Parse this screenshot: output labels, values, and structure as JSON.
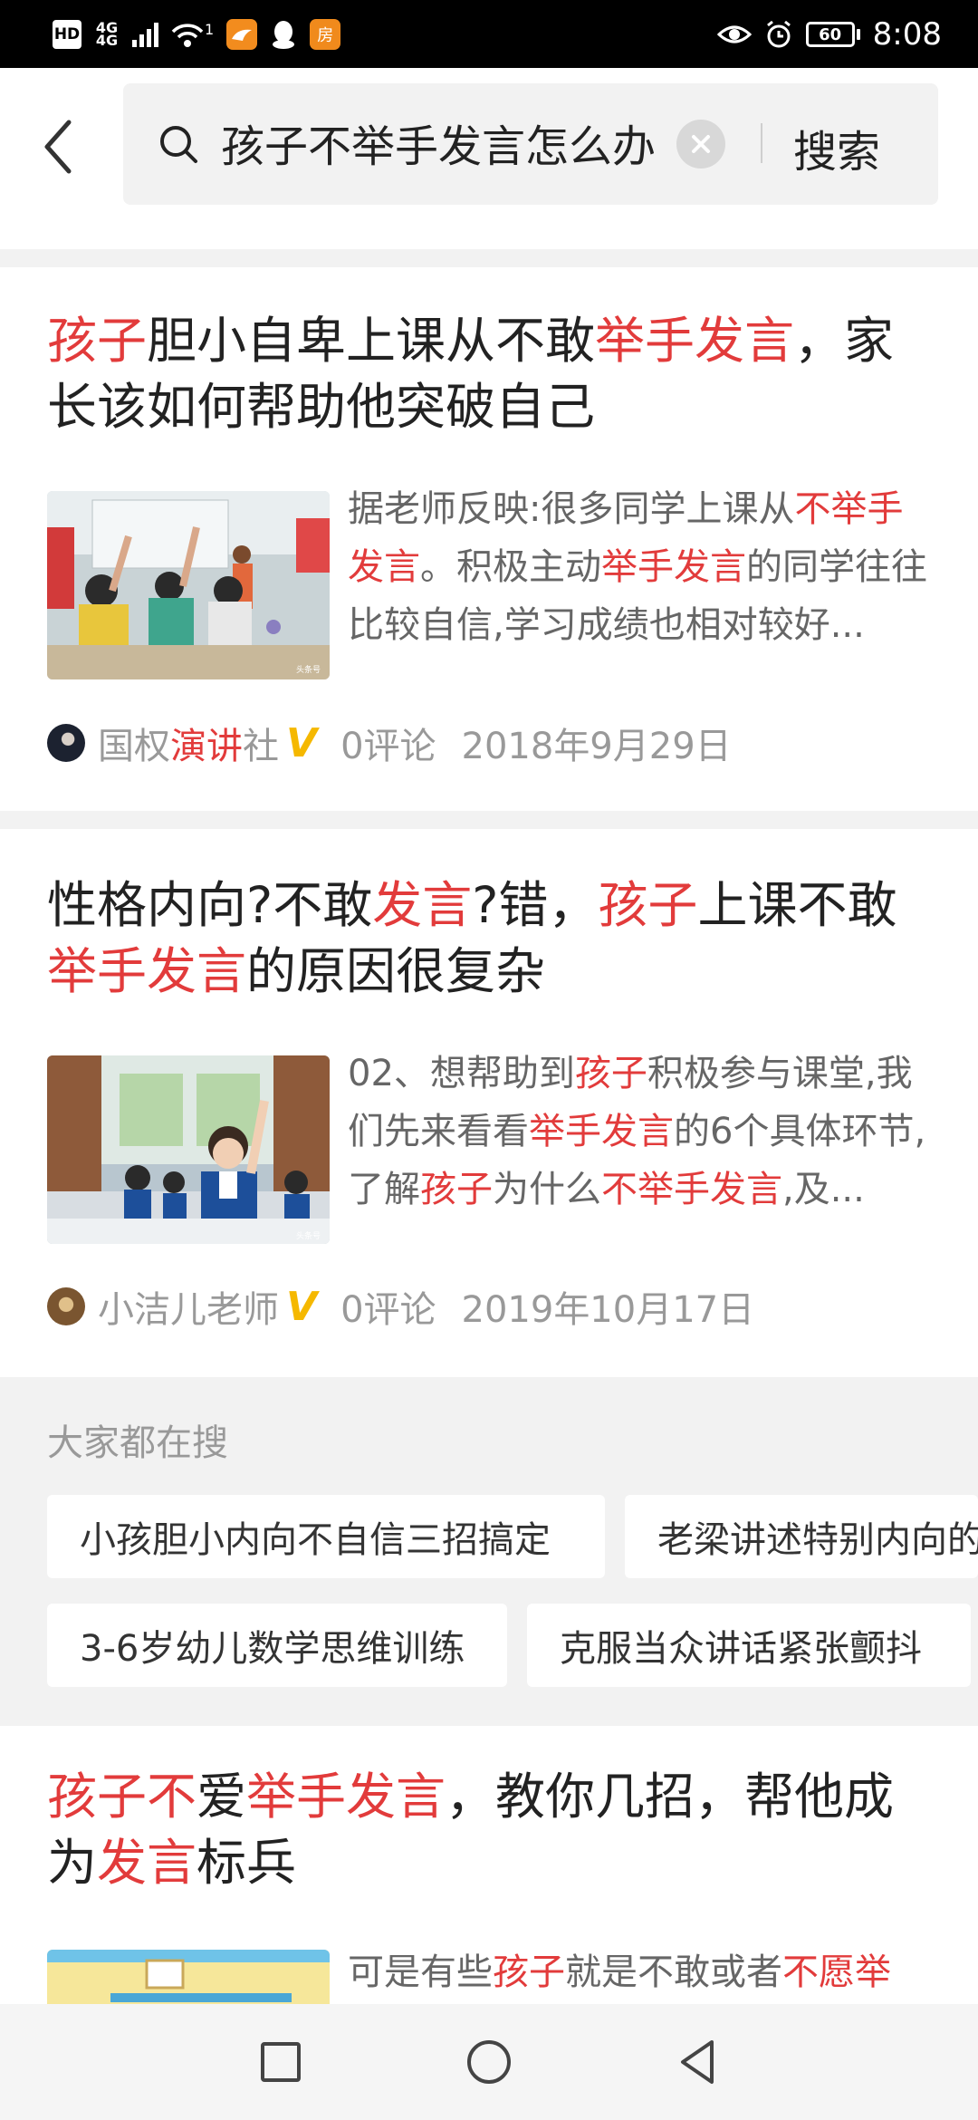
{
  "status_bar": {
    "network_badge": "HD",
    "network_type_top": "4G",
    "network_type_bottom": "4G",
    "wifi_superscript": "1",
    "battery": "60",
    "time": "8:08",
    "app_icon_house_label": "房"
  },
  "search": {
    "query": "孩子不举手发言怎么办",
    "button_label": "搜索"
  },
  "articles": [
    {
      "title_parts": [
        "孩子",
        "胆小自卑上课从不敢",
        "举手发言",
        "，家长该如何帮助他突破自己"
      ],
      "snippet_parts": [
        "据老师反映:很多同学上课从",
        "不举手发言",
        "。积极主动",
        "举手发言",
        "的同学往往比较自信,学习成绩也相对较好..."
      ],
      "author_parts": [
        "国权",
        "演讲",
        "社"
      ],
      "comments": "0评论",
      "date": "2018年9月29日",
      "thumb_watermark": "头条号"
    },
    {
      "title_parts": [
        "性格内向?不敢",
        "发言",
        "?错，",
        "孩子",
        "上课不敢",
        "举手发言",
        "的原因很复杂"
      ],
      "snippet_parts": [
        "02、想帮助到",
        "孩子",
        "积极参与课堂,我们先来看看",
        "举手发言",
        "的6个具体环节,了解",
        "孩子",
        "为什么",
        "不举手发言",
        ",及..."
      ],
      "author": "小洁儿老师",
      "comments": "0评论",
      "date": "2019年10月17日",
      "thumb_watermark": "头条号"
    },
    {
      "title_parts": [
        "孩子不",
        "爱",
        "举手发言",
        "，教你几招，帮他成为",
        "发言",
        "标兵"
      ],
      "snippet_parts": [
        "可是有些",
        "孩子",
        "就是不敢或者",
        "不愿举"
      ]
    }
  ],
  "hot_searches": {
    "title": "大家都在搜",
    "items": [
      "小孩胆小内向不自信三招搞定",
      "老梁讲述特别内向的",
      "3-6岁幼儿数学思维训练",
      "克服当众讲话紧张颤抖"
    ]
  },
  "colors": {
    "highlight": "#e23b3b",
    "v_badge": "#f5b800",
    "band": "#f2f2f2"
  },
  "icons": [
    "back-arrow-icon",
    "search-icon",
    "clear-icon",
    "recent-apps-icon",
    "home-icon",
    "back-nav-icon"
  ]
}
